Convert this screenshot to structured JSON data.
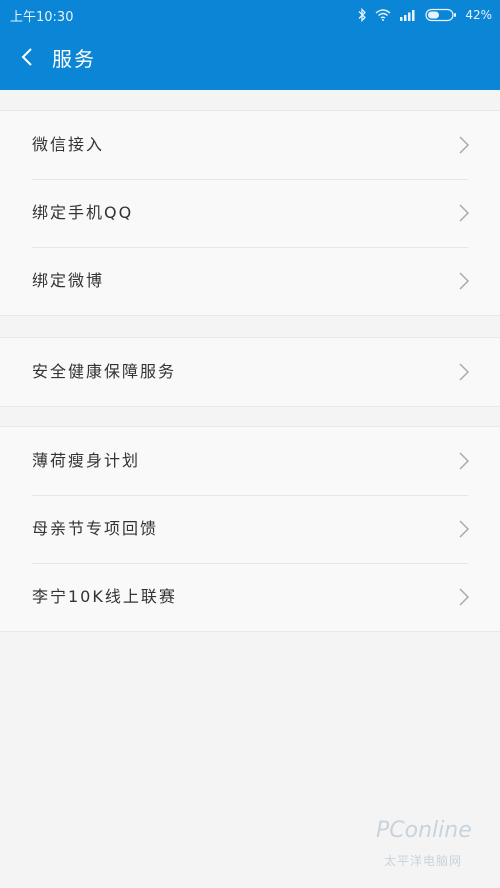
{
  "status_bar": {
    "time": "上午10:30",
    "battery": "42%",
    "icons": [
      "bluetooth-icon",
      "wifi-icon",
      "signal-icon",
      "battery-icon"
    ]
  },
  "header": {
    "title": "服务",
    "back_icon": "chevron-left-icon"
  },
  "groups": [
    {
      "items": [
        {
          "label": "微信接入"
        },
        {
          "label": "绑定手机QQ"
        },
        {
          "label": "绑定微博"
        }
      ]
    },
    {
      "items": [
        {
          "label": "安全健康保障服务"
        }
      ]
    },
    {
      "items": [
        {
          "label": "薄荷瘦身计划"
        },
        {
          "label": "母亲节专项回馈"
        },
        {
          "label": "李宁10K线上联赛"
        }
      ]
    }
  ],
  "colors": {
    "header_bg": "#0b86d6",
    "page_bg": "#f4f4f4",
    "text": "#333333",
    "chevron": "#aaaaaa"
  },
  "watermark": {
    "logo": "PConline",
    "subtitle": "太平洋电脑网"
  }
}
